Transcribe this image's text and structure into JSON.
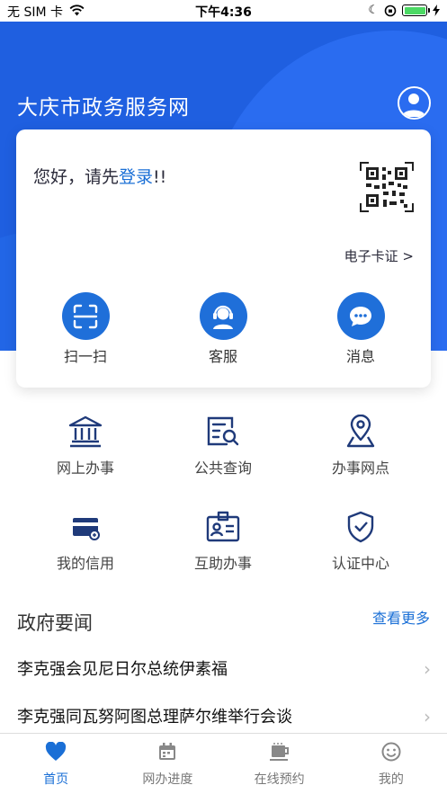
{
  "status_bar": {
    "carrier": "无 SIM 卡",
    "time": "下午4:36"
  },
  "header": {
    "title": "大庆市政务服务网"
  },
  "login_card": {
    "greeting_prefix": "您好，请先",
    "login_link": "登录",
    "greeting_suffix": "!!",
    "cert_link": "电子卡证 >",
    "actions": [
      {
        "label": "扫一扫",
        "icon": "scan-icon"
      },
      {
        "label": "客服",
        "icon": "customer-service-icon"
      },
      {
        "label": "消息",
        "icon": "message-icon"
      }
    ]
  },
  "services": [
    {
      "label": "网上办事",
      "icon": "government-building-icon"
    },
    {
      "label": "公共查询",
      "icon": "document-search-icon"
    },
    {
      "label": "办事网点",
      "icon": "location-pin-icon"
    },
    {
      "label": "我的信用",
      "icon": "credit-card-icon"
    },
    {
      "label": "互助办事",
      "icon": "id-badge-icon"
    },
    {
      "label": "认证中心",
      "icon": "shield-check-icon"
    }
  ],
  "news": {
    "title": "政府要闻",
    "more": "查看更多",
    "items": [
      "李克强会见尼日尔总统伊素福",
      "李克强同瓦努阿图总理萨尔维举行会谈"
    ]
  },
  "tabbar": [
    {
      "label": "首页",
      "icon": "heart-icon",
      "active": true
    },
    {
      "label": "网办进度",
      "icon": "calendar-icon",
      "active": false
    },
    {
      "label": "在线预约",
      "icon": "cup-icon",
      "active": false
    },
    {
      "label": "我的",
      "icon": "smiley-icon",
      "active": false
    }
  ],
  "colors": {
    "primary": "#1f5fe0",
    "accent": "#1a6fd6",
    "battery": "#4cd964"
  }
}
